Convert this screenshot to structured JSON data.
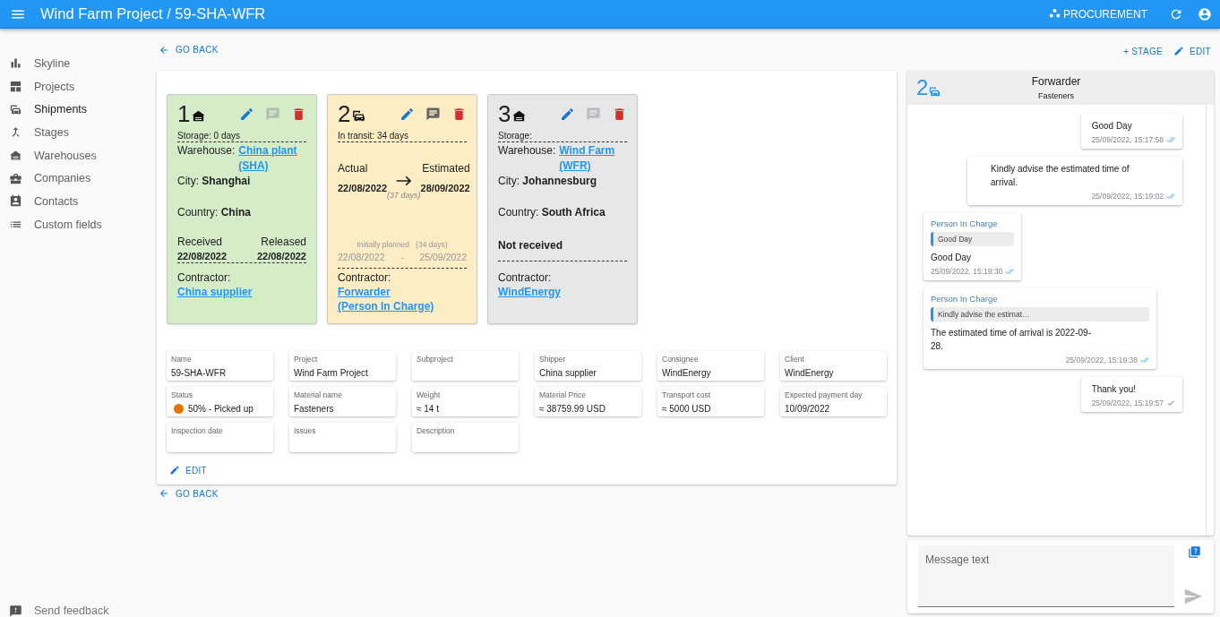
{
  "app_bar": {
    "title": "Wind Farm Project / 59-SHA-WFR",
    "module": "PROCUREMENT"
  },
  "sidebar": {
    "items": [
      {
        "label": "Skyline",
        "selected": false
      },
      {
        "label": "Projects",
        "selected": false
      },
      {
        "label": "Shipments",
        "selected": true
      },
      {
        "label": "Stages",
        "selected": false
      },
      {
        "label": "Warehouses",
        "selected": false
      },
      {
        "label": "Companies",
        "selected": false
      },
      {
        "label": "Contacts",
        "selected": false
      },
      {
        "label": "Custom fields",
        "selected": false
      }
    ],
    "feedback": "Send feedback"
  },
  "go_back_top": "GO BACK",
  "go_back_bottom": "GO BACK",
  "stages": [
    {
      "kind": "warehouse",
      "number": "1",
      "color": "#d5ecc9",
      "has_comments": false,
      "duration": "Storage: 0 days",
      "place_label": "Warehouse:",
      "place": "China plant (SHA)",
      "city_label": "City:",
      "city": "Shanghai",
      "country_label": "Country:",
      "country": "China",
      "received": true,
      "received_label": "Received",
      "received_date": "22/08/2022",
      "released_label": "Released",
      "released_date": "22/08/2022",
      "contractor_label": "Contractor:",
      "contractor": [
        "China supplier"
      ]
    },
    {
      "kind": "transit",
      "number": "2",
      "color": "#fcedc5",
      "has_comments": true,
      "duration": "In transit: 34 days",
      "actual_label": "Actual",
      "actual_date": "22/08/2022",
      "estimated_label": "Estimated",
      "estimated_date": "28/09/2022",
      "span": "(37 days)",
      "planned_label": "Initially planned",
      "planned_span": "(34 days)",
      "planned_start": "22/08/2022",
      "planned_sep": "-",
      "planned_end": "25/09/2022",
      "contractor_label": "Contractor:",
      "contractor": [
        "Forwarder",
        "(Person In Charge)"
      ]
    },
    {
      "kind": "warehouse",
      "number": "3",
      "color": "#e7e7e7",
      "has_comments": false,
      "duration": "Storage:",
      "place_label": "Warehouse:",
      "place": "Wind Farm (WFR)",
      "city_label": "City:",
      "city": "Johannesburg",
      "country_label": "Country:",
      "country": "South Africa",
      "received": false,
      "status_text": "Not received",
      "contractor_label": "Contractor:",
      "contractor": [
        "WindEnergy"
      ]
    }
  ],
  "fields": [
    {
      "label": "Name",
      "value": "59-SHA-WFR"
    },
    {
      "label": "Project",
      "value": "Wind Farm Project"
    },
    {
      "label": "Subproject"
    },
    {
      "label": "Shipper",
      "value": "China supplier"
    },
    {
      "label": "Consignee",
      "value": "WindEnergy"
    },
    {
      "label": "Client",
      "value": "WindEnergy"
    },
    {
      "label": "Status",
      "value": "50% - Picked up",
      "color": "#e37400"
    },
    {
      "label": "Material name",
      "value": "Fasteners"
    },
    {
      "label": "Weight",
      "value": "≈ 14 t"
    },
    {
      "label": "Material Price",
      "value": "≈ 38759.99 USD"
    },
    {
      "label": "Transport cost",
      "value": "≈ 5000 USD"
    },
    {
      "label": "Expected payment day",
      "value": "10/09/2022"
    },
    {
      "label": "Inspection date"
    },
    {
      "label": "Issues"
    },
    {
      "label": "Description"
    }
  ],
  "edit_button": "EDIT",
  "actions": {
    "stage": "+ STAGE",
    "edit": "EDIT"
  },
  "chat": {
    "number": "2",
    "title": "Forwarder",
    "subtitle": "Fasteners",
    "messages": [
      {
        "outgoing": true,
        "text": "Good Day",
        "time": "25/09/2022, 15:17:58",
        "read": true
      },
      {
        "outgoing": true,
        "text": "Kindly advise the estimated time of arrival.",
        "time": "25/09/2022, 15:19:02",
        "read": true
      },
      {
        "outgoing": false,
        "sender": "Person In Charge",
        "quote": "Good Day",
        "text": "Good Day",
        "time": "25/09/2022, 15:19:30",
        "read": true
      },
      {
        "outgoing": false,
        "sender": "Person In Charge",
        "quote": "Kindly advise the estimat…",
        "text": "The estimated time of arrival is 2022-09-28.",
        "time": "25/09/2022, 15:19:38",
        "read": true
      },
      {
        "outgoing": true,
        "text": "Thank you!",
        "time": "25/09/2022, 15:19:57",
        "read": false
      }
    ],
    "placeholder": "Message text"
  }
}
